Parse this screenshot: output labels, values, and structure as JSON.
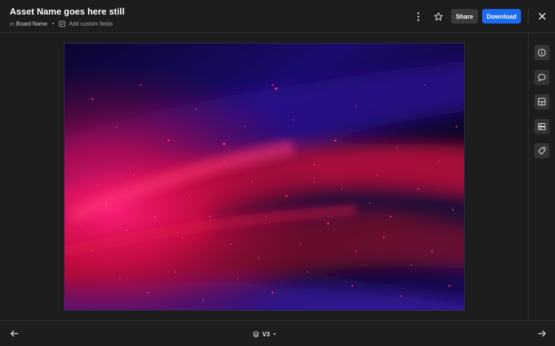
{
  "header": {
    "title": "Asset Name goes here still",
    "in_label": "in",
    "board_name": "Board Name",
    "separator": "•",
    "add_fields_label": "Add custom fields",
    "more_icon": "more-vertical-icon",
    "star_icon": "star-icon",
    "share_label": "Share",
    "download_label": "Download",
    "close_icon": "close-icon"
  },
  "sidebar": {
    "items": [
      {
        "icon": "info-icon"
      },
      {
        "icon": "comment-icon"
      },
      {
        "icon": "layout-icon"
      },
      {
        "icon": "storage-icon"
      },
      {
        "icon": "tag-icon"
      }
    ]
  },
  "footer": {
    "prev_icon": "arrow-left-icon",
    "next_icon": "arrow-right-icon",
    "version_label": "V3",
    "version_caret": "▾"
  },
  "colors": {
    "background": "#1d1d1d",
    "accent": "#1c6cf2",
    "share_bg": "#3a3a3a",
    "sidebar_button_bg": "#343434"
  }
}
